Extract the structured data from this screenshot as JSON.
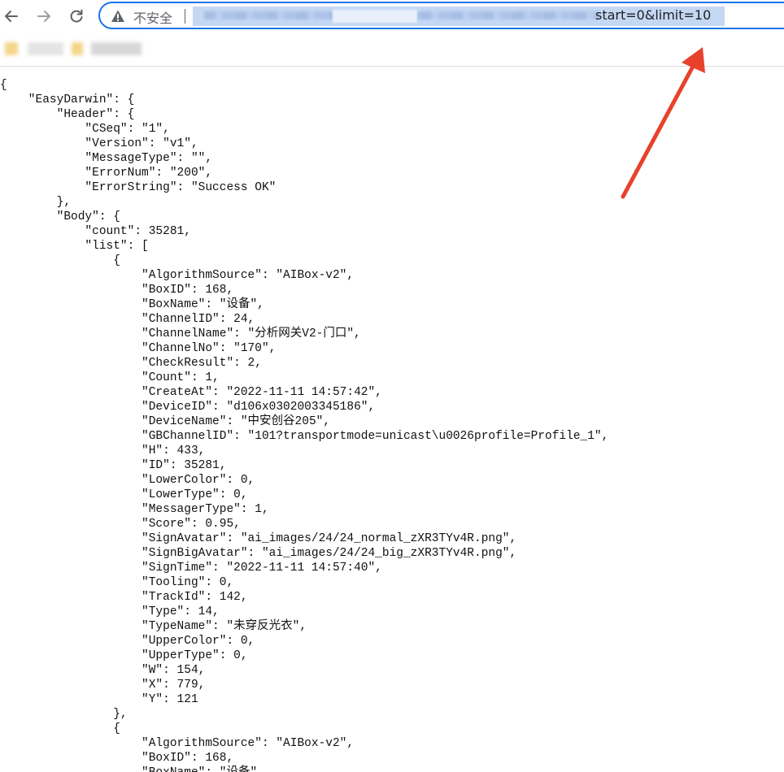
{
  "browser": {
    "security_label": "不安全",
    "url_visible_text": "start=0&limit=10",
    "icons": {
      "back": "arrow-left-icon",
      "forward": "arrow-right-icon",
      "reload": "reload-icon",
      "security": "warning-triangle-icon"
    },
    "accent_color": "#1a73e8",
    "selection_color": "#c5d8f3"
  },
  "annotation": {
    "arrow_color": "#e8412c"
  },
  "json_text": "{\n    \"EasyDarwin\": {\n        \"Header\": {\n            \"CSeq\": \"1\",\n            \"Version\": \"v1\",\n            \"MessageType\": \"\",\n            \"ErrorNum\": \"200\",\n            \"ErrorString\": \"Success OK\"\n        },\n        \"Body\": {\n            \"count\": 35281,\n            \"list\": [\n                {\n                    \"AlgorithmSource\": \"AIBox-v2\",\n                    \"BoxID\": 168,\n                    \"BoxName\": \"设备\",\n                    \"ChannelID\": 24,\n                    \"ChannelName\": \"分析网关V2-门口\",\n                    \"ChannelNo\": \"170\",\n                    \"CheckResult\": 2,\n                    \"Count\": 1,\n                    \"CreateAt\": \"2022-11-11 14:57:42\",\n                    \"DeviceID\": \"d106x0302003345186\",\n                    \"DeviceName\": \"中安创谷205\",\n                    \"GBChannelID\": \"101?transportmode=unicast\\u0026profile=Profile_1\",\n                    \"H\": 433,\n                    \"ID\": 35281,\n                    \"LowerColor\": 0,\n                    \"LowerType\": 0,\n                    \"MessagerType\": 1,\n                    \"Score\": 0.95,\n                    \"SignAvatar\": \"ai_images/24/24_normal_zXR3TYv4R.png\",\n                    \"SignBigAvatar\": \"ai_images/24/24_big_zXR3TYv4R.png\",\n                    \"SignTime\": \"2022-11-11 14:57:40\",\n                    \"Tooling\": 0,\n                    \"TrackId\": 142,\n                    \"Type\": 14,\n                    \"TypeName\": \"未穿反光衣\",\n                    \"UpperColor\": 0,\n                    \"UpperType\": 0,\n                    \"W\": 154,\n                    \"X\": 779,\n                    \"Y\": 121\n                },\n                {\n                    \"AlgorithmSource\": \"AIBox-v2\",\n                    \"BoxID\": 168,\n                    \"BoxName\": \"设备\","
}
